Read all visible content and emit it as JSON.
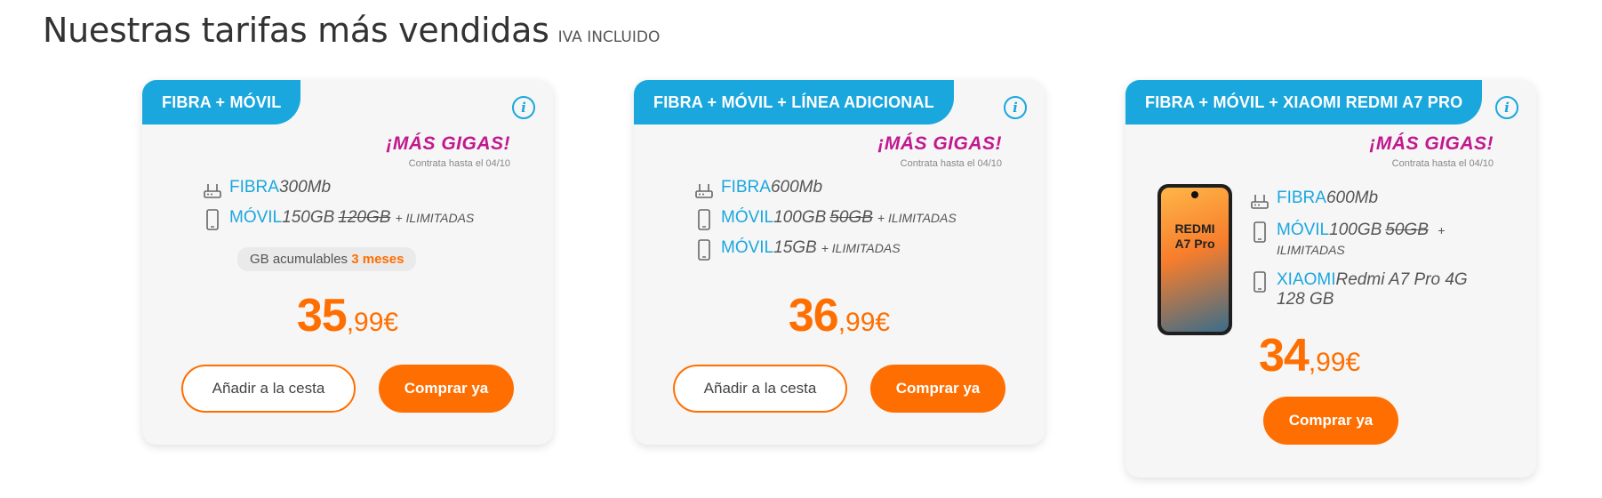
{
  "header": {
    "title": "Nuestras tarifas más vendidas",
    "subtitle": "IVA INCLUIDO"
  },
  "colors": {
    "accent_orange": "#ff6e00",
    "accent_blue": "#1aa7de",
    "promo_magenta": "#c2188f"
  },
  "cards": [
    {
      "tag": "FIBRA + MÓVIL",
      "info_icon": "info-icon",
      "promo_title": "¡MÁS GIGAS!",
      "promo_sub": "Contrata hasta el 04/10",
      "features": [
        {
          "icon": "router-icon",
          "label": "FIBRA",
          "value": "300Mb"
        },
        {
          "icon": "phone-icon",
          "label": "MÓVIL",
          "value": "150GB",
          "old": "120GB",
          "extra": "+ ILIMITADAS"
        }
      ],
      "accumulable": {
        "text": "GB acumulables",
        "highlight": "3 meses"
      },
      "price": {
        "integer": "35",
        "decimal": ",99€"
      },
      "add_to_cart": "Añadir a la cesta",
      "buy_now": "Comprar ya"
    },
    {
      "tag": "FIBRA + MÓVIL + LÍNEA ADICIONAL",
      "info_icon": "info-icon",
      "promo_title": "¡MÁS GIGAS!",
      "promo_sub": "Contrata hasta el 04/10",
      "features": [
        {
          "icon": "router-icon",
          "label": "FIBRA",
          "value": "600Mb"
        },
        {
          "icon": "phone-icon",
          "label": "MÓVIL",
          "value": "100GB",
          "old": "50GB",
          "extra": "+ ILIMITADAS"
        },
        {
          "icon": "phone-icon",
          "label": "MÓVIL",
          "value": "15GB",
          "extra": "+ ILIMITADAS"
        }
      ],
      "price": {
        "integer": "36",
        "decimal": ",99€"
      },
      "add_to_cart": "Añadir a la cesta",
      "buy_now": "Comprar ya"
    },
    {
      "tag": "FIBRA + MÓVIL + XIAOMI REDMI A7 PRO",
      "info_icon": "info-icon",
      "promo_title": "¡MÁS GIGAS!",
      "promo_sub": "Contrata hasta el 04/10",
      "phone_image_text": [
        "REDMI",
        "A7 Pro"
      ],
      "features": [
        {
          "icon": "router-icon",
          "label": "FIBRA",
          "value": "600Mb"
        },
        {
          "icon": "phone-icon",
          "label": "MÓVIL",
          "value": "100GB",
          "old": "50GB",
          "extra": "+ ILIMITADAS"
        },
        {
          "icon": "phone-icon",
          "label": "XIAOMI",
          "value": "Redmi A7 Pro 4G 128 GB"
        }
      ],
      "price": {
        "integer": "34",
        "decimal": ",99€"
      },
      "buy_now": "Comprar ya"
    }
  ]
}
